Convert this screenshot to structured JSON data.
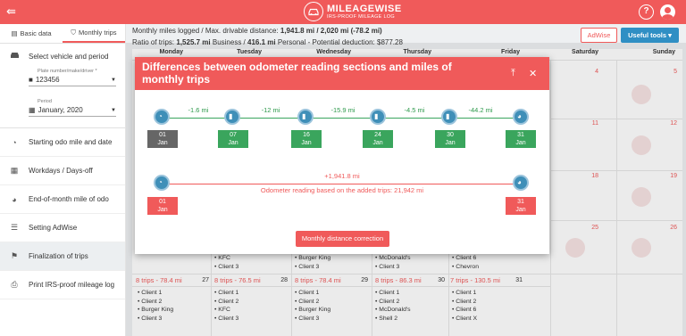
{
  "app": {
    "logo_title": "MILEAGEWISE",
    "logo_subtitle": "IRS-PROOF MILEAGE LOG"
  },
  "topbar": {
    "help_icon": "help-circle-icon",
    "user_icon": "account-icon",
    "back_icon": "collapse-menu-icon"
  },
  "sidebar": {
    "tabs": [
      {
        "label": "Basic data",
        "icon": "document-icon"
      },
      {
        "label": "Monthly trips",
        "icon": "road-icon"
      }
    ],
    "select_vehicle": "Select vehicle and period",
    "plate_label": "Plate number/make/driver *",
    "plate_value": "123456",
    "period_label": "Period",
    "period_value": "January, 2020",
    "nav": [
      {
        "label": "Starting odo mile and date",
        "icon": "odometer-icon"
      },
      {
        "label": "Workdays / Days-off",
        "icon": "calendar-icon"
      },
      {
        "label": "End-of-month mile of odo",
        "icon": "odometer-end-icon"
      },
      {
        "label": "Setting AdWise",
        "icon": "sliders-icon"
      },
      {
        "label": "Finalization of trips",
        "icon": "flag-icon"
      },
      {
        "label": "Print IRS-proof mileage log",
        "icon": "print-icon"
      }
    ]
  },
  "stats": {
    "line1_prefix": "Monthly miles logged / Max. drivable distance:",
    "line1_value": "1,941.8 mi / 2,020 mi (-78.2 mi)",
    "line2_prefix": "Ratio of trips:",
    "line2_business": "1,525.7 mi",
    "line2_business_suffix": "Business /",
    "line2_personal": "416.1 mi",
    "line2_personal_suffix": "Personal - Potential deduction: $877.28"
  },
  "buttons": {
    "adwise": "AdWise",
    "tools": "Useful tools ▾"
  },
  "calendar": {
    "days": [
      "Monday",
      "Tuesday",
      "Wednesday",
      "Thursday",
      "Friday",
      "Saturday",
      "Sunday"
    ],
    "right_days": [
      [
        "4",
        "5"
      ],
      [
        "11",
        "12"
      ],
      [
        "18",
        "19"
      ],
      [
        "25",
        "26"
      ]
    ],
    "row4_lists": [
      [
        "KFC",
        "Client 3"
      ],
      [
        "Burger King",
        "Client 3"
      ],
      [
        "McDonald's",
        "Client 3"
      ],
      [
        "Client 6",
        "Chevron"
      ]
    ],
    "row5": [
      {
        "head": "8 trips - 78.4 mi",
        "day": "27",
        "items": [
          "Client 1",
          "Client 2",
          "Burger King",
          "Client 3"
        ]
      },
      {
        "head": "8 trips - 76.5 mi",
        "day": "28",
        "items": [
          "Client 1",
          "Client 2",
          "KFC",
          "Client 3"
        ]
      },
      {
        "head": "8 trips - 78.4 mi",
        "day": "29",
        "items": [
          "Client 1",
          "Client 2",
          "Burger King",
          "Client 3"
        ]
      },
      {
        "head": "8 trips - 86.3 mi",
        "day": "30",
        "items": [
          "Client 1",
          "Client 2",
          "McDonald's",
          "Shell 2"
        ]
      },
      {
        "head": "7 trips - 130.5 mi",
        "day": "31",
        "items": [
          "Client 1",
          "Client 2",
          "Client 6",
          "Client X"
        ]
      }
    ]
  },
  "modal": {
    "title": "Differences between odometer reading sections and miles of monthly trips",
    "pin_icon": "pin-top-icon",
    "close_icon": "close-icon",
    "sections": [
      {
        "day": "01",
        "month": "Jan",
        "color": "#666666"
      },
      {
        "day": "07",
        "month": "Jan",
        "color": "#3aa55d"
      },
      {
        "day": "16",
        "month": "Jan",
        "color": "#3aa55d"
      },
      {
        "day": "24",
        "month": "Jan",
        "color": "#3aa55d"
      },
      {
        "day": "30",
        "month": "Jan",
        "color": "#3aa55d"
      },
      {
        "day": "31",
        "month": "Jan",
        "color": "#3aa55d"
      }
    ],
    "diffs": [
      "-1.6 mi",
      "-12 mi",
      "-15.9 mi",
      "-4.5 mi",
      "-44.2 mi"
    ],
    "total": {
      "diff": "+1,941.8 mi",
      "note": "Odometer reading based on the added trips: 21,942 mi",
      "start_day": "01",
      "start_month": "Jan",
      "end_day": "31",
      "end_month": "Jan",
      "color": "#f05a5a"
    },
    "correction_button": "Monthly distance correction"
  }
}
